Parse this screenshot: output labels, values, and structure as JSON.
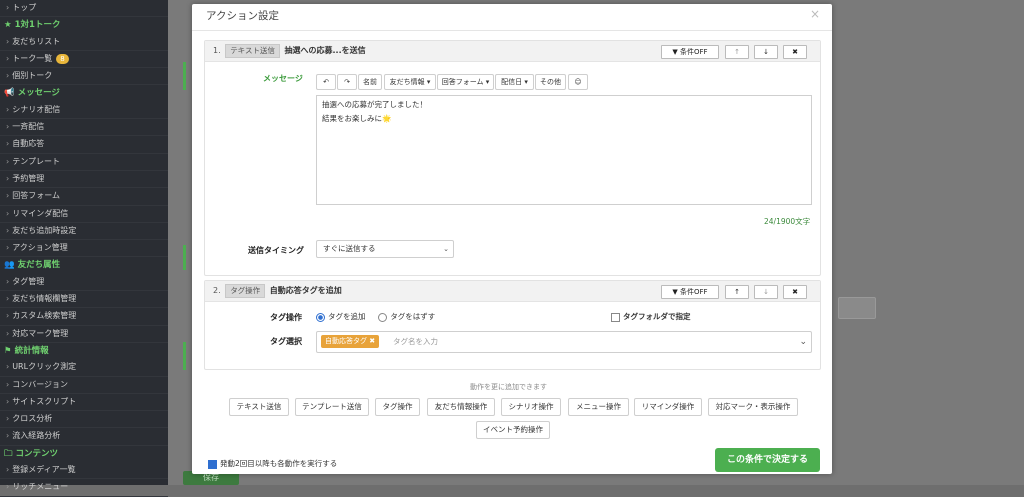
{
  "sidebar": {
    "items": [
      {
        "type": "item",
        "label": "トップ"
      },
      {
        "type": "section",
        "icon": "star-icon",
        "label": "1対1トーク"
      },
      {
        "type": "item",
        "label": "友だちリスト"
      },
      {
        "type": "item",
        "label": "トーク一覧",
        "badge": "8"
      },
      {
        "type": "item",
        "label": "個別トーク"
      },
      {
        "type": "section",
        "icon": "megaphone-icon",
        "label": "メッセージ"
      },
      {
        "type": "item",
        "label": "シナリオ配信"
      },
      {
        "type": "item",
        "label": "一斉配信"
      },
      {
        "type": "item",
        "label": "自動応答"
      },
      {
        "type": "item",
        "label": "テンプレート"
      },
      {
        "type": "item",
        "label": "予約管理"
      },
      {
        "type": "item",
        "label": "回答フォーム"
      },
      {
        "type": "item",
        "label": "リマインダ配信"
      },
      {
        "type": "item",
        "label": "友だち追加時設定"
      },
      {
        "type": "item",
        "label": "アクション管理"
      },
      {
        "type": "section",
        "icon": "users-icon",
        "label": "友だち属性"
      },
      {
        "type": "item",
        "label": "タグ管理"
      },
      {
        "type": "item",
        "label": "友だち情報欄管理"
      },
      {
        "type": "item",
        "label": "カスタム検索管理"
      },
      {
        "type": "item",
        "label": "対応マーク管理"
      },
      {
        "type": "section",
        "icon": "flag-icon",
        "label": "統計情報"
      },
      {
        "type": "item",
        "label": "URLクリック測定"
      },
      {
        "type": "item",
        "label": "コンバージョン"
      },
      {
        "type": "item",
        "label": "サイトスクリプト"
      },
      {
        "type": "item",
        "label": "クロス分析"
      },
      {
        "type": "item",
        "label": "流入経路分析"
      },
      {
        "type": "section",
        "icon": "folder-icon",
        "label": "コンテンツ"
      },
      {
        "type": "item",
        "label": "登録メディア一覧"
      },
      {
        "type": "item",
        "label": "リッチメニュー"
      }
    ]
  },
  "background": {
    "button_label": "保存"
  },
  "modal": {
    "title": "アクション設定",
    "close": "×",
    "card1": {
      "num": "1.",
      "chip": "テキスト送信",
      "title": "抽選への応募...を送信",
      "cond_btn": "条件OFF",
      "up": "↑",
      "down": "↓",
      "remove": "✖",
      "message_label": "メッセージ",
      "toolbar": [
        "↶",
        "↷",
        "名前",
        "友だち情報 ▾",
        "回答フォーム ▾",
        "配信日 ▾",
        "その他",
        "☺"
      ],
      "message_lines": [
        "抽選への応募が完了しました！",
        "結果をお楽しみに🌟"
      ],
      "char_count": "24/1900文字",
      "timing_label": "送信タイミング",
      "timing_value": "すぐに送信する",
      "timing_caret": "⌄"
    },
    "card2": {
      "num": "2.",
      "chip": "タグ操作",
      "title": "自動応答タグを追加",
      "cond_btn": "条件OFF",
      "up": "↑",
      "down": "↓",
      "remove": "✖",
      "op_label": "タグ操作",
      "radio_add": "タグを追加",
      "radio_remove": "タグをはずす",
      "folder_check": "タグフォルダで指定",
      "select_label": "タグ選択",
      "selected_tag": "自動応答タグ ✖",
      "tag_placeholder": "タグ名を入力",
      "tag_caret": "⌄"
    },
    "add_note": "動作を更に追加できます",
    "add_buttons": [
      "テキスト送信",
      "テンプレート送信",
      "タグ操作",
      "友だち情報操作",
      "シナリオ操作",
      "メニュー操作",
      "リマインダ操作",
      "対応マーク・表示操作",
      "イベント予約操作"
    ],
    "footer_check": "発動2回目以降も各動作を実行する",
    "confirm": "この条件で決定する"
  },
  "colors": {
    "accent": "#4caf50",
    "sidebar_bg": "#2a2d33",
    "section_green": "#6fd06f",
    "tag_orange": "#e8a33a"
  }
}
